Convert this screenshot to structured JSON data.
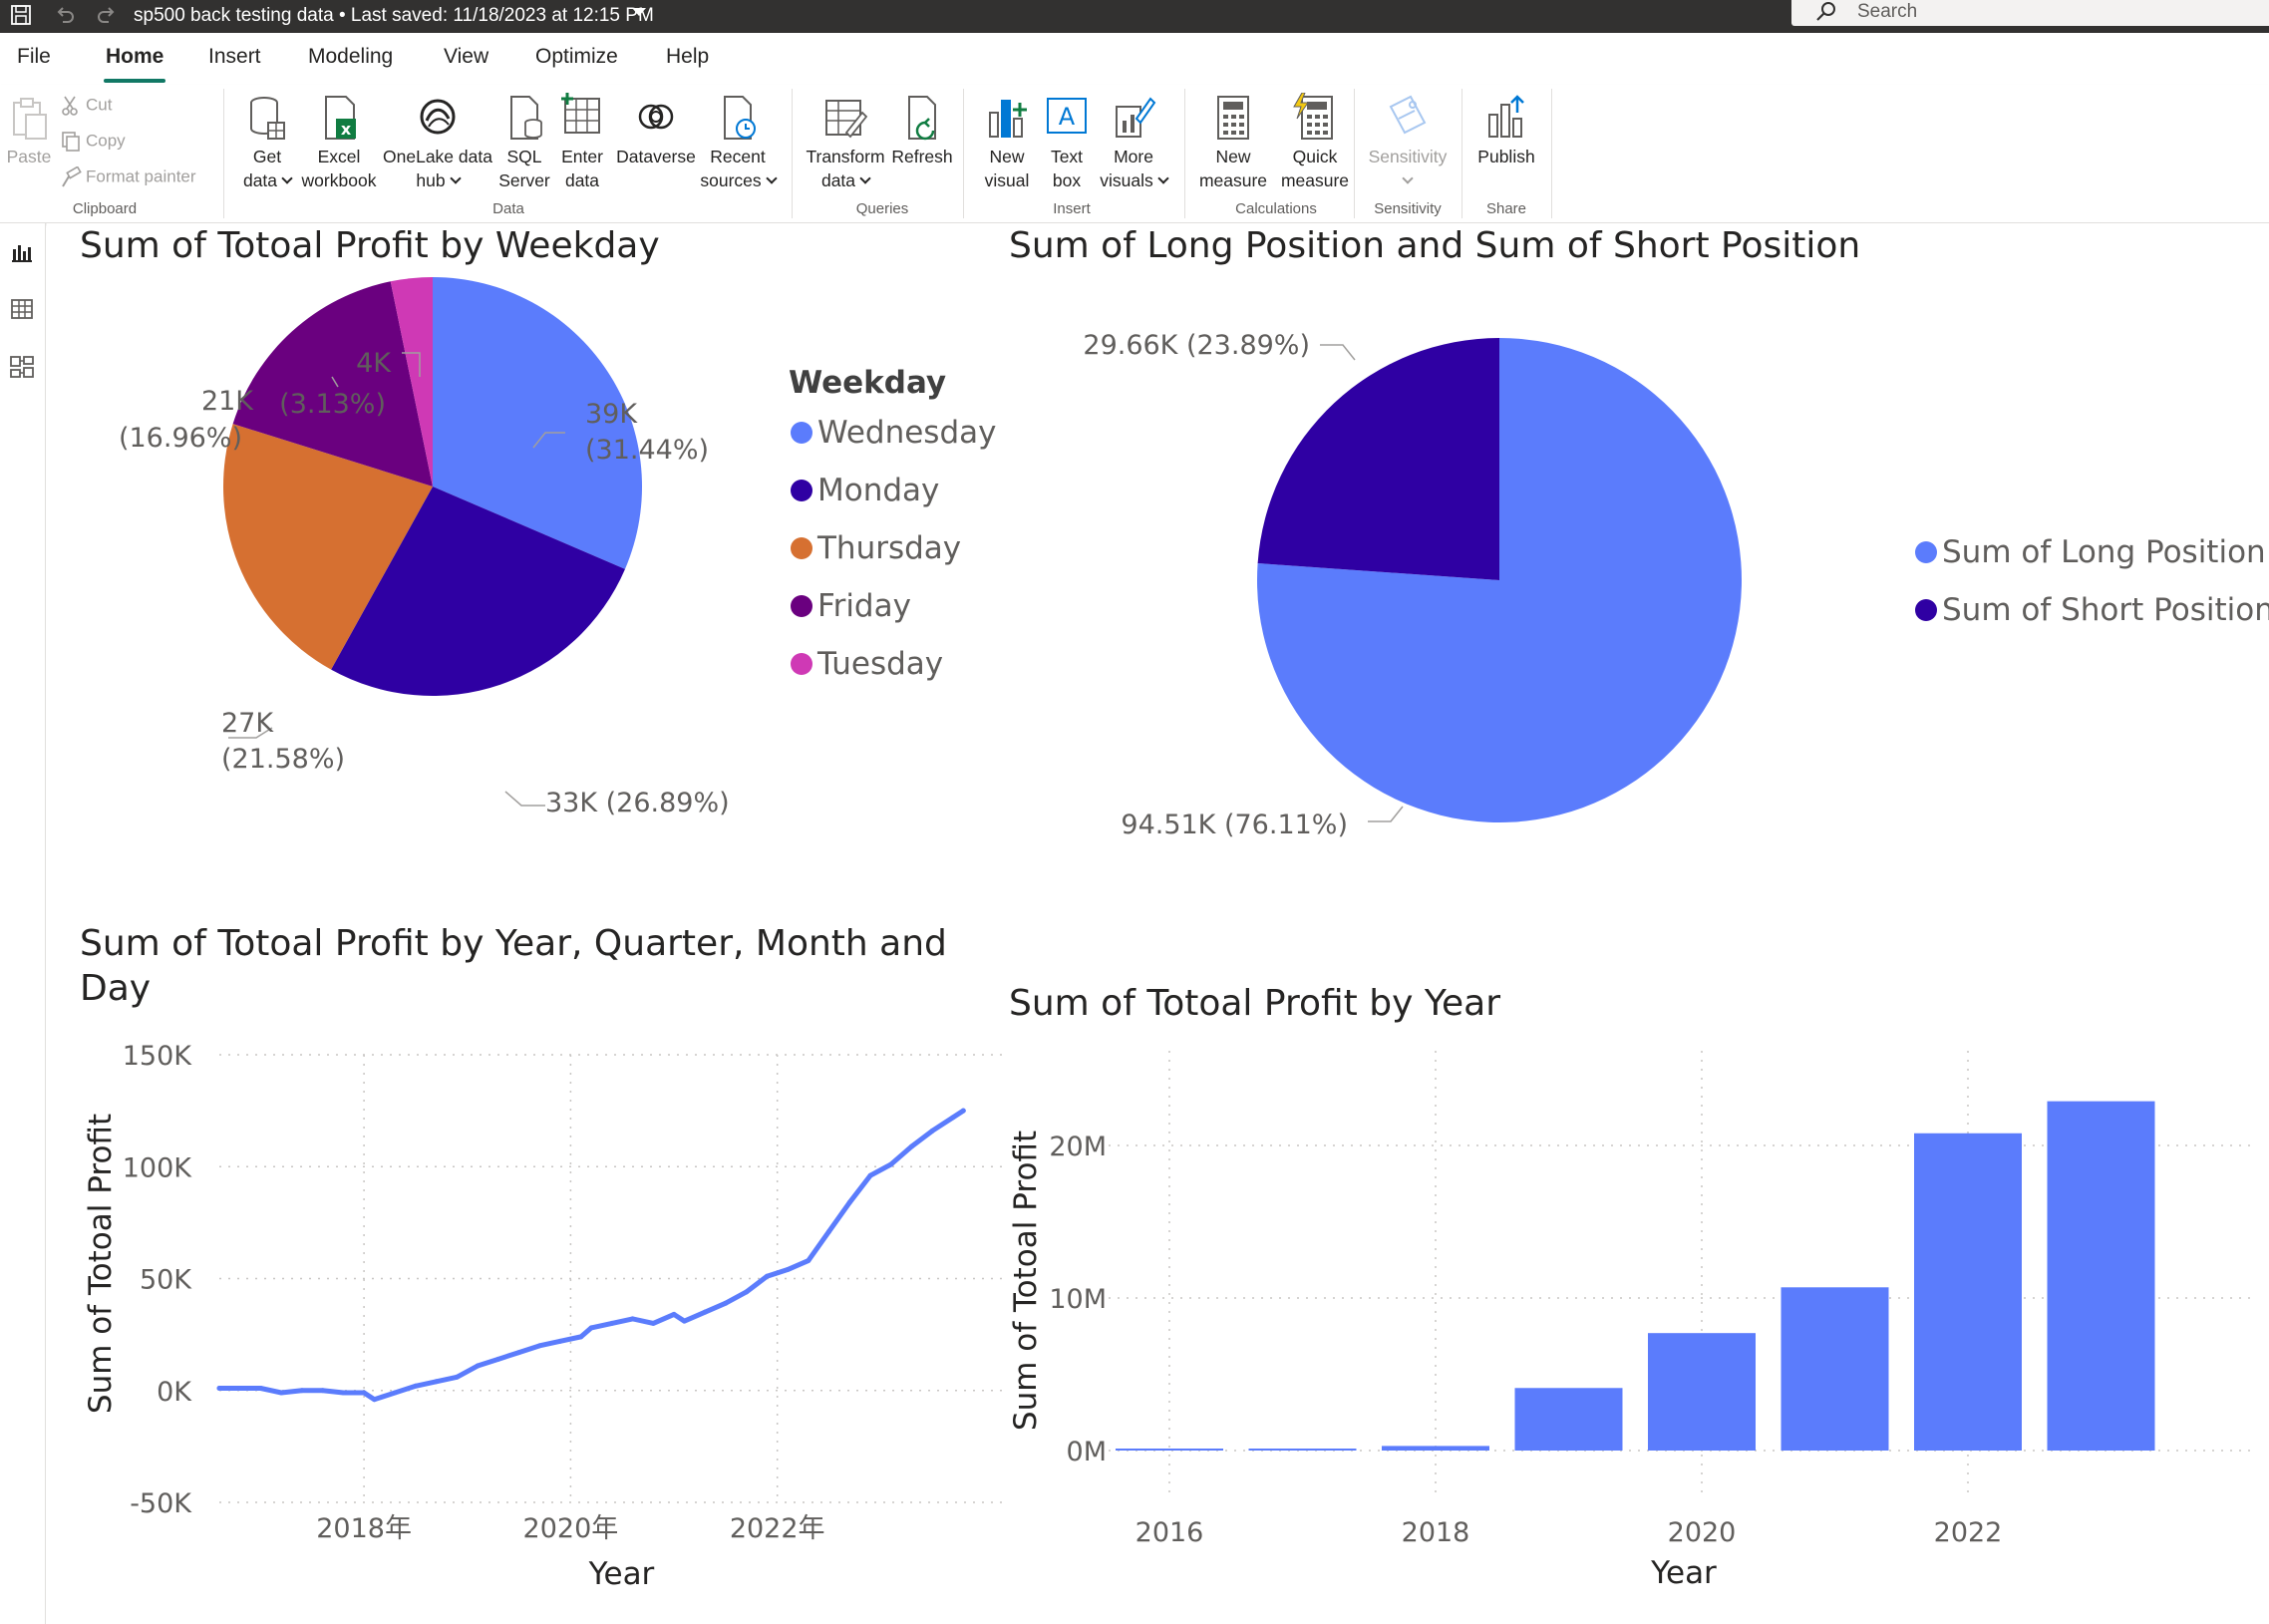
{
  "titlebar": {
    "title": "sp500 back testing data",
    "separator": "•",
    "last_saved": "Last saved: 11/18/2023 at 12:15 PM",
    "search_placeholder": "Search"
  },
  "menu": {
    "tabs": [
      "File",
      "Home",
      "Insert",
      "Modeling",
      "View",
      "Optimize",
      "Help"
    ],
    "active": "Home"
  },
  "ribbon": {
    "clipboard": {
      "group_label": "Clipboard",
      "paste": "Paste",
      "cut": "Cut",
      "copy": "Copy",
      "format_painter": "Format painter"
    },
    "data": {
      "group_label": "Data",
      "get_data": [
        "Get",
        "data"
      ],
      "excel": [
        "Excel",
        "workbook"
      ],
      "onelake": [
        "OneLake data",
        "hub"
      ],
      "sql": [
        "SQL",
        "Server"
      ],
      "enter_data": [
        "Enter",
        "data"
      ],
      "dataverse": [
        "Dataverse",
        ""
      ],
      "recent": [
        "Recent",
        "sources"
      ]
    },
    "queries": {
      "group_label": "Queries",
      "transform": [
        "Transform",
        "data"
      ],
      "refresh": [
        "Refresh",
        ""
      ]
    },
    "insert": {
      "group_label": "Insert",
      "new_visual": [
        "New",
        "visual"
      ],
      "text_box": [
        "Text",
        "box"
      ],
      "more_visuals": [
        "More",
        "visuals"
      ]
    },
    "calculations": {
      "group_label": "Calculations",
      "new_measure": [
        "New",
        "measure"
      ],
      "quick_measure": [
        "Quick",
        "measure"
      ]
    },
    "sensitivity": {
      "group_label": "Sensitivity",
      "sensitivity": [
        "Sensitivity",
        ""
      ]
    },
    "share": {
      "group_label": "Share",
      "publish": [
        "Publish",
        ""
      ]
    }
  },
  "left_rail": {
    "icons": [
      "report-view-icon",
      "table-view-icon",
      "model-view-icon"
    ]
  },
  "colors": {
    "blue": "#5b7cfc",
    "navy": "#2f00a3",
    "orange": "#d67031",
    "purple": "#6a007f",
    "magenta": "#cf39b5",
    "titlebar": "#323130",
    "accent": "#117865"
  },
  "chart_data": [
    {
      "type": "pie",
      "title": "Sum of Totoal Profit by Weekday",
      "legend_title": "Weekday",
      "legend_position": "right",
      "slices": [
        {
          "name": "Wednesday",
          "value": 39,
          "value_label": "39K",
          "pct_label": "(31.44%)",
          "color": "#5b7cfc"
        },
        {
          "name": "Monday",
          "value": 33,
          "value_label": "33K",
          "pct_label": "(26.89%)",
          "color": "#2f00a3"
        },
        {
          "name": "Thursday",
          "value": 27,
          "value_label": "27K",
          "pct_label": "(21.58%)",
          "color": "#d67031"
        },
        {
          "name": "Friday",
          "value": 21,
          "value_label": "21K",
          "pct_label": "(16.96%)",
          "color": "#6a007f"
        },
        {
          "name": "Tuesday",
          "value": 4,
          "value_label": "4K",
          "pct_label": "(3.13%)",
          "color": "#cf39b5"
        }
      ],
      "percentages": [
        31.44,
        26.89,
        21.58,
        16.96,
        3.13
      ]
    },
    {
      "type": "pie",
      "title": "Sum of Long Position and Sum of Short Position",
      "legend_position": "right",
      "slices": [
        {
          "name": "Sum of Long Position",
          "value": 94.51,
          "label": "94.51K (76.11%)",
          "color": "#5b7cfc"
        },
        {
          "name": "Sum of Short Position",
          "value": 29.66,
          "label": "29.66K (23.89%)",
          "color": "#2f00a3"
        }
      ],
      "percentages": [
        76.11,
        23.89
      ]
    },
    {
      "type": "line",
      "title": "Sum of Totoal Profit by Year, Quarter, Month and Day",
      "title_lines": [
        "Sum of Totoal Profit by Year, Quarter, Month and",
        "Day"
      ],
      "xlabel": "Year",
      "ylabel": "Sum of Totoal Profit",
      "x_ticks": [
        "2018年",
        "2020年",
        "2022年"
      ],
      "y_ticks": [
        "150K",
        "100K",
        "50K",
        "0K",
        "-50K"
      ],
      "xlim": [
        2016.6,
        2024.0
      ],
      "ylim": [
        -50,
        150
      ],
      "grid": true,
      "series": [
        {
          "color": "#5b7cfc",
          "x": [
            2016.6,
            2016.8,
            2017.0,
            2017.2,
            2017.4,
            2017.6,
            2017.8,
            2018.0,
            2018.1,
            2018.3,
            2018.5,
            2018.7,
            2018.9,
            2019.1,
            2019.3,
            2019.5,
            2019.7,
            2019.9,
            2020.1,
            2020.2,
            2020.4,
            2020.6,
            2020.8,
            2021.0,
            2021.1,
            2021.3,
            2021.5,
            2021.7,
            2021.9,
            2022.1,
            2022.3,
            2022.5,
            2022.7,
            2022.9,
            2023.1,
            2023.3,
            2023.5,
            2023.7,
            2023.8
          ],
          "y": [
            1,
            1,
            1,
            -1,
            0,
            0,
            -1,
            -1,
            -4,
            -1,
            2,
            4,
            6,
            11,
            14,
            17,
            20,
            22,
            24,
            28,
            30,
            32,
            30,
            34,
            31,
            35,
            39,
            44,
            51,
            54,
            58,
            71,
            84,
            96,
            101,
            109,
            116,
            122,
            125
          ]
        }
      ]
    },
    {
      "type": "bar",
      "title": "Sum of Totoal Profit by Year",
      "xlabel": "Year",
      "ylabel": "Sum of Totoal Profit",
      "categories": [
        "2016",
        "2017",
        "2018",
        "2019",
        "2020",
        "2021",
        "2022",
        "2023"
      ],
      "x_tick_labels": [
        "2016",
        "2018",
        "2020",
        "2022"
      ],
      "values": [
        0.05,
        0.1,
        0.3,
        4.1,
        7.7,
        10.7,
        20.8,
        22.9
      ],
      "y_ticks": [
        "20M",
        "10M",
        "0M"
      ],
      "ylim": [
        0,
        24
      ],
      "grid": true,
      "color": "#5b7cfc"
    }
  ]
}
